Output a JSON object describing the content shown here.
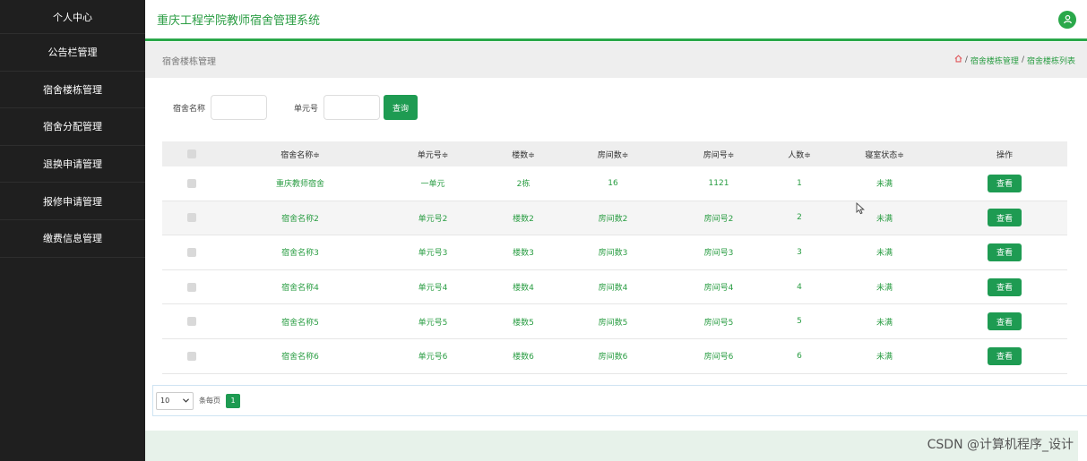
{
  "sidebar": {
    "items": [
      {
        "label": "个人中心"
      },
      {
        "label": "公告栏管理"
      },
      {
        "label": "宿舍楼栋管理"
      },
      {
        "label": "宿舍分配管理"
      },
      {
        "label": "退换申请管理"
      },
      {
        "label": "报修申请管理"
      },
      {
        "label": "缴费信息管理"
      }
    ]
  },
  "header": {
    "title": "重庆工程学院教师宿舍管理系统",
    "avatar_icon": "user-icon",
    "accent_color": "#2aa84a"
  },
  "breadcrumb": {
    "page_title": "宿舍楼栋管理",
    "home_icon": "home-icon",
    "items": [
      "宿舍楼栋管理",
      "宿舍楼栋列表"
    ]
  },
  "search": {
    "name_label": "宿舍名称",
    "name_value": "",
    "unit_label": "单元号",
    "unit_value": "",
    "button_label": "查询"
  },
  "table": {
    "headers": [
      "宿舍名称≑",
      "单元号≑",
      "楼数≑",
      "房间数≑",
      "房间号≑",
      "人数≑",
      "寝室状态≑",
      "操作"
    ],
    "action_label": "查看",
    "rows": [
      {
        "name": "重庆教师宿舍",
        "unit": "一单元",
        "floors": "2栋",
        "rooms": "16",
        "room_no": "1121",
        "people": "1",
        "status": "未满"
      },
      {
        "name": "宿舍名称2",
        "unit": "单元号2",
        "floors": "楼数2",
        "rooms": "房间数2",
        "room_no": "房间号2",
        "people": "2",
        "status": "未满"
      },
      {
        "name": "宿舍名称3",
        "unit": "单元号3",
        "floors": "楼数3",
        "rooms": "房间数3",
        "room_no": "房间号3",
        "people": "3",
        "status": "未满"
      },
      {
        "name": "宿舍名称4",
        "unit": "单元号4",
        "floors": "楼数4",
        "rooms": "房间数4",
        "room_no": "房间号4",
        "people": "4",
        "status": "未满"
      },
      {
        "name": "宿舍名称5",
        "unit": "单元号5",
        "floors": "楼数5",
        "rooms": "房间数5",
        "room_no": "房间号5",
        "people": "5",
        "status": "未满"
      },
      {
        "name": "宿舍名称6",
        "unit": "单元号6",
        "floors": "楼数6",
        "rooms": "房间数6",
        "room_no": "房间号6",
        "people": "6",
        "status": "未满"
      }
    ]
  },
  "pagination": {
    "page_size": "10",
    "per_page_text": "条每页",
    "current_page": "1"
  },
  "watermark": "CSDN @计算机程序_设计"
}
